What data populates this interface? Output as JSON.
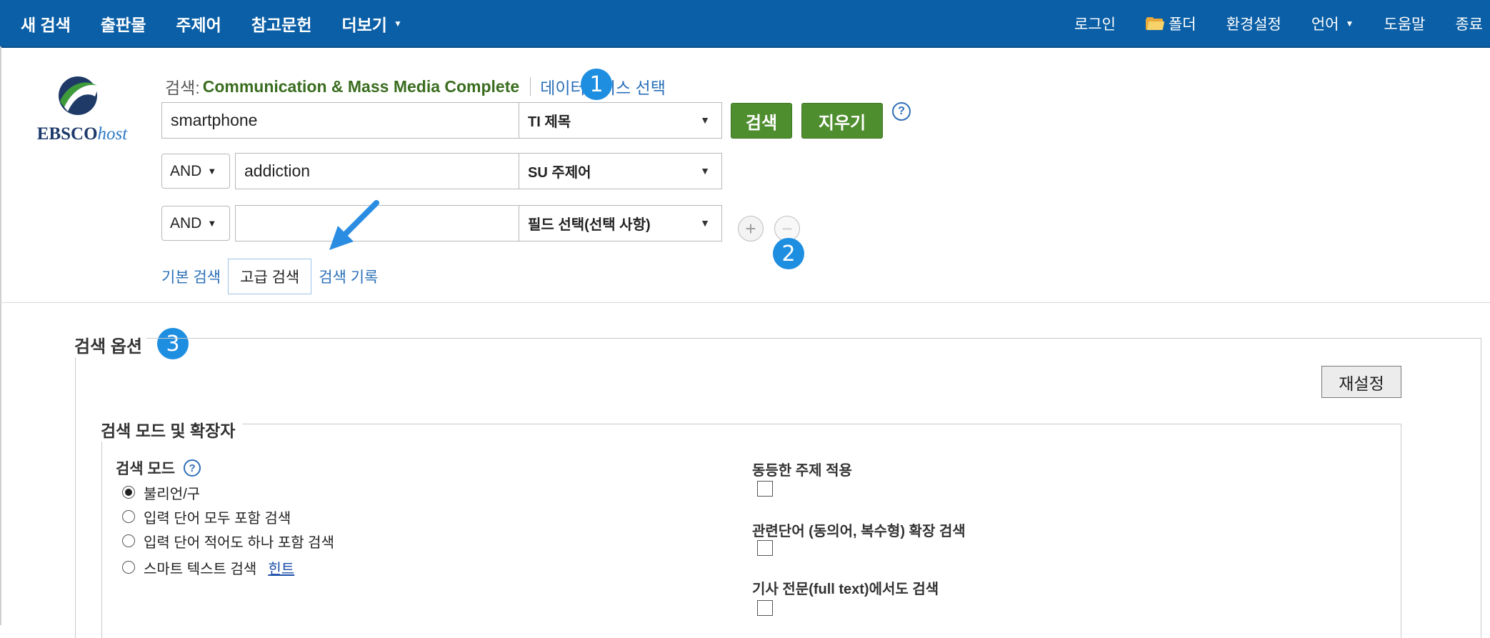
{
  "nav": {
    "left": [
      "새 검색",
      "출판물",
      "주제어",
      "참고문헌",
      "더보기"
    ],
    "right": {
      "login": "로그인",
      "folder": "폴더",
      "preferences": "환경설정",
      "language": "언어",
      "help": "도움말",
      "exit": "종료"
    }
  },
  "logo": {
    "text_bold": "EBSCO",
    "text_italic": "host"
  },
  "search": {
    "label": "검색:",
    "database": "Communication & Mass Media Complete",
    "choose_db_link": "데이터베이스 선택",
    "rows": [
      {
        "term": "smartphone",
        "field": "TI 제목"
      },
      {
        "bool": "AND",
        "term": "addiction",
        "field": "SU 주제어"
      },
      {
        "bool": "AND",
        "term": "",
        "field": "필드 선택(선택 사항)"
      }
    ],
    "search_button": "검색",
    "clear_button": "지우기",
    "help": "?"
  },
  "tabs": {
    "basic": "기본 검색",
    "advanced": "고급 검색",
    "history": "검색 기록"
  },
  "badges": [
    "1",
    "2",
    "3"
  ],
  "options": {
    "title": "검색 옵션",
    "reset": "재설정",
    "modes_title": "검색 모드 및 확장자",
    "search_mode_label": "검색 모드",
    "help": "?",
    "modes": [
      "불리언/구",
      "입력 단어 모두 포함 검색",
      "입력 단어 적어도 하나 포함 검색",
      "스마트 텍스트 검색"
    ],
    "hint": "힌트",
    "expanders": [
      {
        "label": "동등한 주제 적용",
        "checked": false
      },
      {
        "label": "관련단어 (동의어, 복수형) 확장 검색",
        "checked": false
      },
      {
        "label": "기사 전문(full text)에서도 검색",
        "checked": false
      }
    ]
  },
  "colors": {
    "nav_bg": "#0b5fa6",
    "green": "#4f8e2f",
    "link": "#2a6fb8",
    "badge": "#1e8ee0"
  }
}
